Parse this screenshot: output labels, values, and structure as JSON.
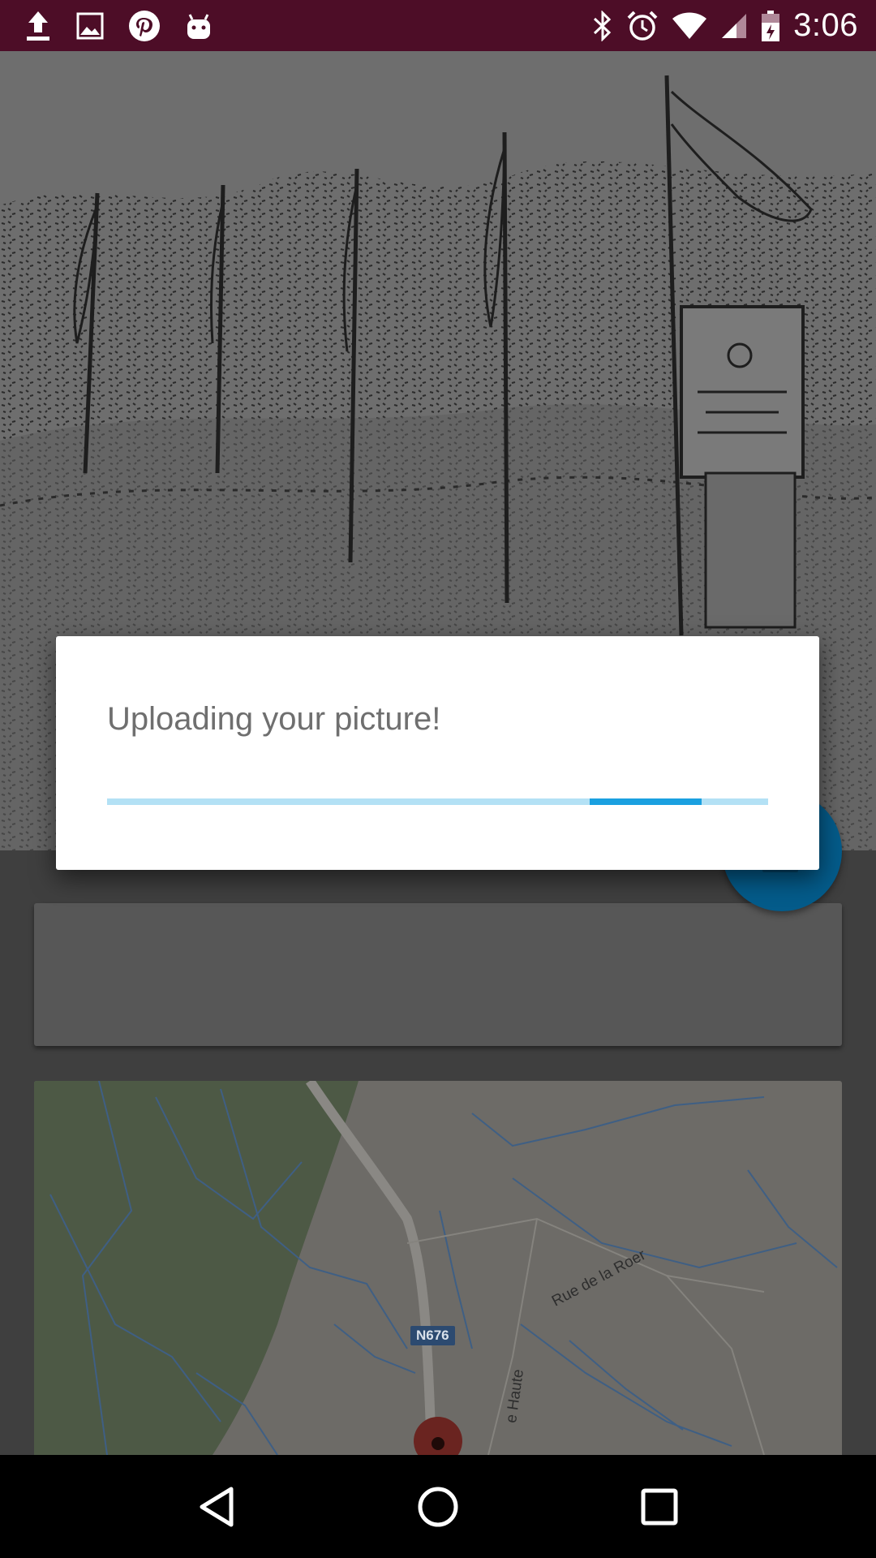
{
  "status_bar": {
    "time": "3:06",
    "left_icons": [
      "upload-icon",
      "image-icon",
      "pinterest-icon",
      "android-icon"
    ],
    "right_icons": [
      "bluetooth-icon",
      "alarm-icon",
      "wifi-icon",
      "cell-signal-icon",
      "battery-icon"
    ],
    "background": "#4d0d27"
  },
  "dialog": {
    "message": "Uploading your picture!",
    "progress": {
      "indeterminate": true,
      "segment_start": 0.73,
      "segment_end": 0.9
    }
  },
  "map": {
    "road_badge": "N676",
    "street_labels": [
      "Rue de la Roer",
      "e Haute"
    ],
    "marker": "map-pin-icon"
  },
  "fab": {
    "color": "#045b8a"
  },
  "nav_bar": {
    "icons": [
      "back-icon",
      "home-icon",
      "recents-icon"
    ]
  }
}
